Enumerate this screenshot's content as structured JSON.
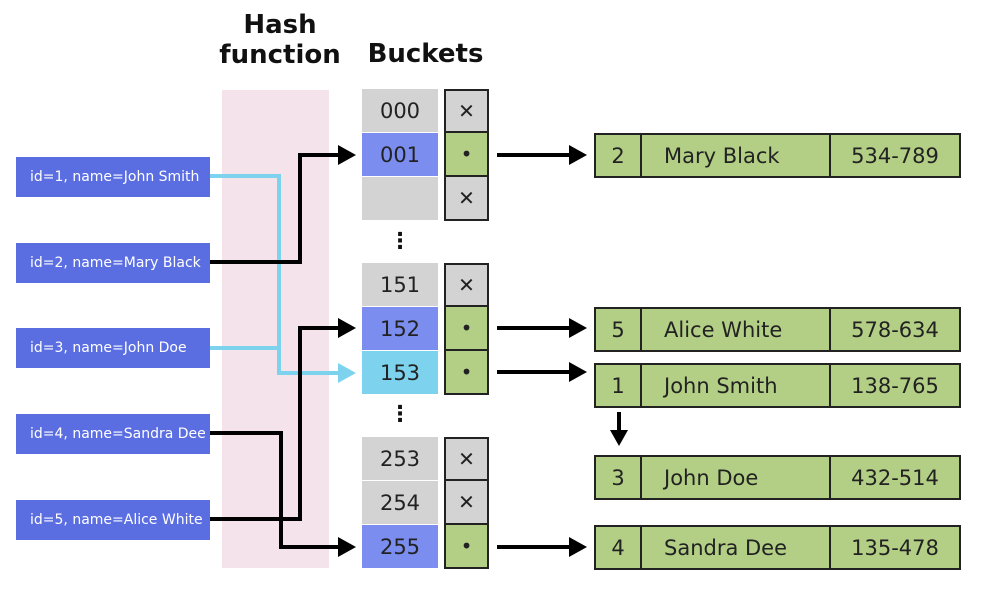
{
  "headings": {
    "hash_function": "Hash\nfunction",
    "buckets": "Buckets"
  },
  "colors": {
    "input": "#5b6ee1",
    "key_gray": "#d3d3d3",
    "key_blue": "#7b8ef0",
    "key_cyan": "#7dd3ee",
    "status_green": "#b3cf85",
    "record_green": "#b3cf85",
    "band_pink": "#f5e3ec",
    "line_black": "#000000",
    "line_cyan": "#7dd3ee"
  },
  "inputs": [
    {
      "label": "id=1, name=John Smith"
    },
    {
      "label": "id=2, name=Mary Black"
    },
    {
      "label": "id=3, name=John Doe"
    },
    {
      "label": "id=4, name=Sandra Dee"
    },
    {
      "label": "id=5, name=Alice White"
    }
  ],
  "buckets": [
    {
      "key": "000",
      "status": "✕",
      "style": "gray"
    },
    {
      "key": "001",
      "status": "•",
      "style": "blue"
    },
    {
      "key": "",
      "status": "✕",
      "style": "gray"
    },
    {
      "key": "151",
      "status": "✕",
      "style": "gray"
    },
    {
      "key": "152",
      "status": "•",
      "style": "blue"
    },
    {
      "key": "153",
      "status": "•",
      "style": "cyan"
    },
    {
      "key": "253",
      "status": "✕",
      "style": "gray"
    },
    {
      "key": "254",
      "status": "✕",
      "style": "gray"
    },
    {
      "key": "255",
      "status": "•",
      "style": "blue"
    }
  ],
  "ellipsis": "⋮",
  "records": [
    {
      "id": "2",
      "name": "Mary Black",
      "phone": "534-789"
    },
    {
      "id": "5",
      "name": "Alice White",
      "phone": "578-634"
    },
    {
      "id": "1",
      "name": "John Smith",
      "phone": "138-765"
    },
    {
      "id": "3",
      "name": "John Doe",
      "phone": "432-514"
    },
    {
      "id": "4",
      "name": "Sandra Dee",
      "phone": "135-478"
    }
  ]
}
